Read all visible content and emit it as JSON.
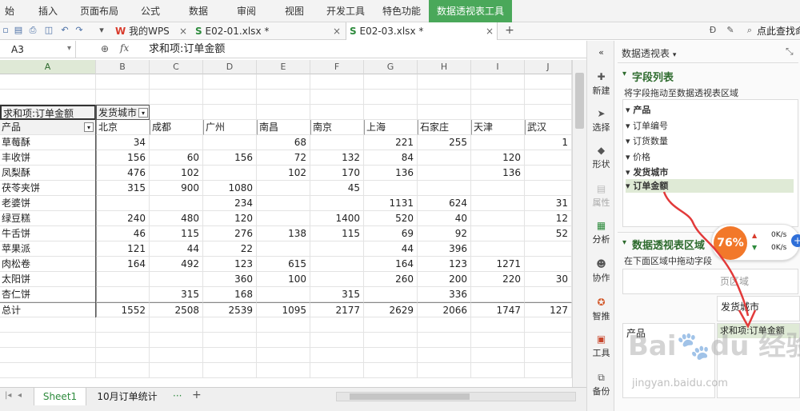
{
  "ribbon": {
    "tabs": [
      "始",
      "插入",
      "页面布局",
      "公式",
      "数据",
      "审阅",
      "视图",
      "开发工具",
      "特色功能",
      "数据透视表工具"
    ]
  },
  "toolbar": {
    "doc_tabs": [
      "我的WPS",
      "E02-01.xlsx *",
      "E02-03.xlsx *"
    ],
    "search_label": "点此查找命"
  },
  "formula_bar": {
    "name_box": "A3",
    "fx_label": "fx",
    "content": "求和项:订单金额"
  },
  "grid": {
    "columns": [
      "A",
      "B",
      "C",
      "D",
      "E",
      "F",
      "G",
      "H",
      "I",
      "J"
    ],
    "pivot_header": "求和项:订单金额",
    "col_field": "发货城市",
    "row_field": "产品",
    "cities": [
      "北京",
      "成都",
      "广州",
      "南昌",
      "南京",
      "上海",
      "石家庄",
      "天津",
      "武汉"
    ],
    "rows": [
      {
        "name": "草莓酥",
        "vals": [
          "34",
          "",
          "",
          "68",
          "",
          "221",
          "255",
          "",
          "1"
        ]
      },
      {
        "name": "丰收饼",
        "vals": [
          "156",
          "60",
          "156",
          "72",
          "132",
          "84",
          "",
          "120",
          ""
        ]
      },
      {
        "name": "凤梨酥",
        "vals": [
          "476",
          "102",
          "",
          "102",
          "170",
          "136",
          "",
          "136",
          ""
        ]
      },
      {
        "name": "茯苓夹饼",
        "vals": [
          "315",
          "900",
          "1080",
          "",
          "45",
          "",
          "",
          "",
          ""
        ]
      },
      {
        "name": "老婆饼",
        "vals": [
          "",
          "",
          "234",
          "",
          "",
          "1131",
          "624",
          "",
          "31"
        ]
      },
      {
        "name": "绿豆糕",
        "vals": [
          "240",
          "480",
          "120",
          "",
          "1400",
          "520",
          "40",
          "",
          "12"
        ]
      },
      {
        "name": "牛舌饼",
        "vals": [
          "46",
          "115",
          "276",
          "138",
          "115",
          "69",
          "92",
          "",
          "52"
        ]
      },
      {
        "name": "苹果派",
        "vals": [
          "121",
          "44",
          "22",
          "",
          "",
          "44",
          "396",
          "",
          ""
        ]
      },
      {
        "name": "肉松卷",
        "vals": [
          "164",
          "492",
          "123",
          "615",
          "",
          "164",
          "123",
          "1271",
          ""
        ]
      },
      {
        "name": "太阳饼",
        "vals": [
          "",
          "",
          "360",
          "100",
          "",
          "260",
          "200",
          "220",
          "30"
        ]
      },
      {
        "name": "杏仁饼",
        "vals": [
          "",
          "315",
          "168",
          "",
          "315",
          "",
          "336",
          "",
          ""
        ]
      }
    ],
    "total_label": "总计",
    "totals": [
      "1552",
      "2508",
      "2539",
      "1095",
      "2177",
      "2629",
      "2066",
      "1747",
      "127"
    ]
  },
  "side_buttons": [
    "新建",
    "选择",
    "形状",
    "属性",
    "分析",
    "协作",
    "智推",
    "工具",
    "备份"
  ],
  "pivot_panel": {
    "title": "数据透视表",
    "field_list_title": "字段列表",
    "field_list_hint": "将字段拖动至数据透视表区域",
    "fields": [
      "产品",
      "订单编号",
      "订货数量",
      "价格",
      "发货城市",
      "订单金额"
    ],
    "area_title": "数据透视表区域",
    "area_hint": "在下面区域中拖动字段",
    "filter_area": "页区域",
    "col_area": "发货城市",
    "row_area": "产品",
    "value_area": "求和项:订单金额"
  },
  "speed_widget": {
    "percent": "76%",
    "up": "0K/s",
    "down": "0K/s"
  },
  "sheets": [
    "Sheet1",
    "10月订单统计"
  ],
  "watermark": {
    "logo": "Bai du 经验",
    "url": "jingyan.baidu.com"
  }
}
